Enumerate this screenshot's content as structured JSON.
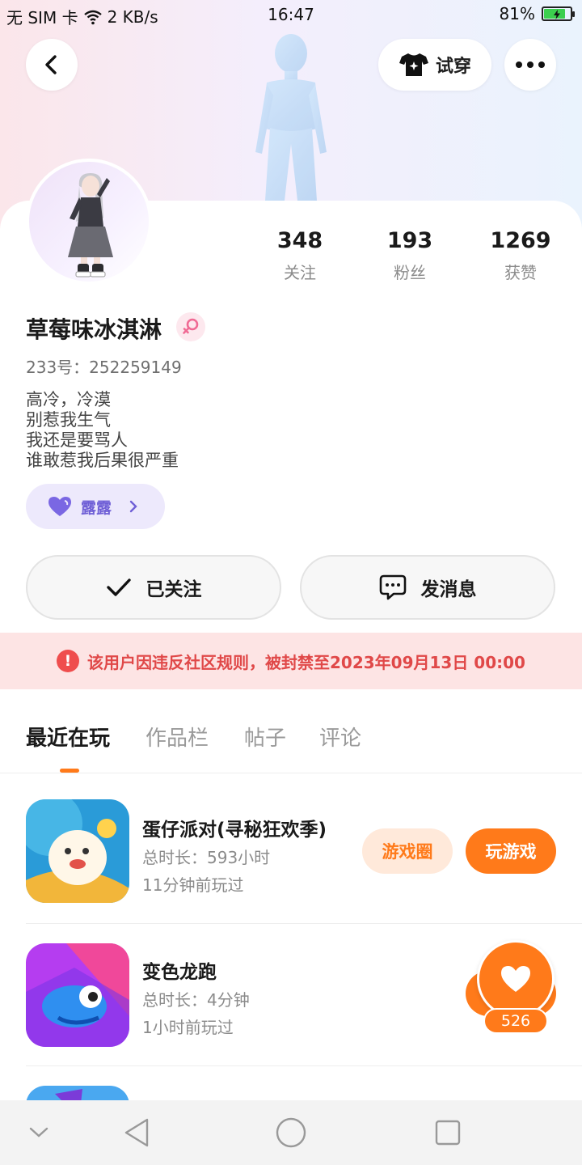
{
  "status_bar": {
    "carrier": "无 SIM 卡",
    "speed": "2 KB/s",
    "time": "16:47",
    "battery_pct": "81%",
    "battery_level": 0.81
  },
  "header": {
    "tryon_label": "试穿"
  },
  "stats": [
    {
      "value": "348",
      "label": "关注"
    },
    {
      "value": "193",
      "label": "粉丝"
    },
    {
      "value": "1269",
      "label": "获赞"
    }
  ],
  "profile": {
    "name": "草莓味冰淇淋",
    "uid": "233号：252259149",
    "bio": [
      "高冷，冷漠",
      "别惹我生气",
      "我还是要骂人",
      "谁敢惹我后果很严重"
    ],
    "tag_label": "露露"
  },
  "actions": {
    "follow_label": "已关注",
    "message_label": "发消息"
  },
  "ban_notice": {
    "text": "该用户因违反社区规则，被封禁至2023年09月13日 00:00"
  },
  "tabs": [
    "最近在玩",
    "作品栏",
    "帖子",
    "评论"
  ],
  "games": [
    {
      "title": "蛋仔派对(寻秘狂欢季)",
      "duration": "总时长：593小时",
      "last_played": "11分钟前玩过",
      "circle_label": "游戏圈",
      "play_label": "玩游戏"
    },
    {
      "title": "变色龙跑",
      "duration": "总时长：4分钟",
      "last_played": "1小时前玩过"
    }
  ],
  "like_button": {
    "count": "526"
  },
  "colors": {
    "accent": "#ff7a1a",
    "ban_text": "#e04848",
    "tag_purple": "#6f5fd6"
  }
}
